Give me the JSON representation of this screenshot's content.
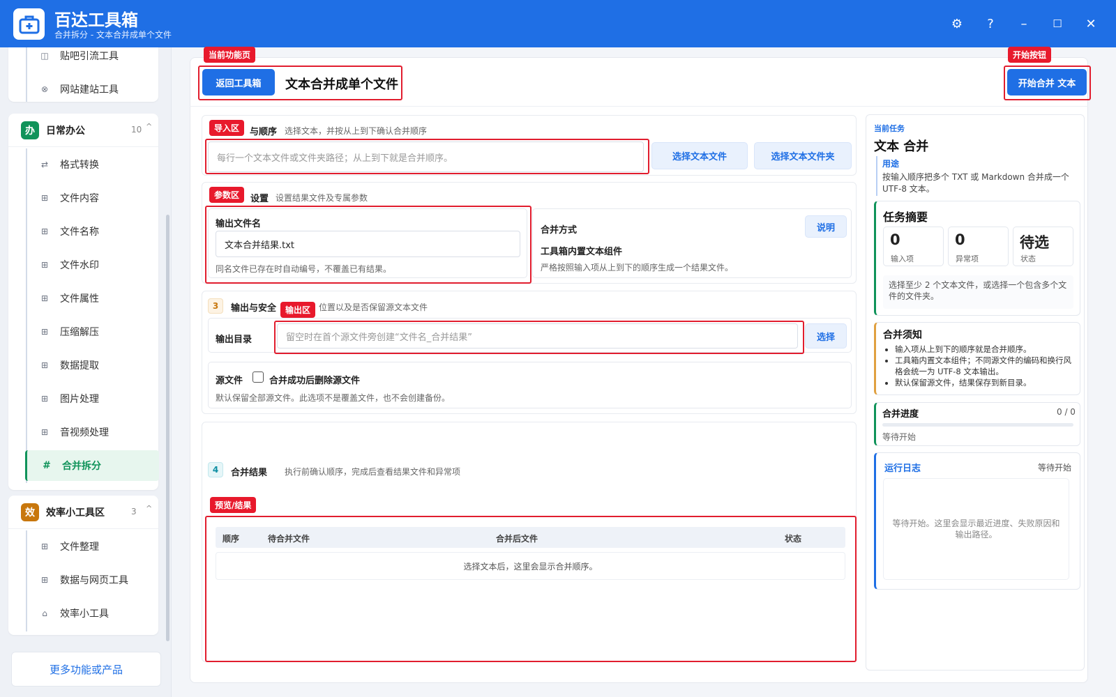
{
  "app": {
    "title": "百达工具箱",
    "subtitle": "合并拆分 - 文本合并成单个文件"
  },
  "window_controls": {
    "settings": "⚙",
    "help": "?",
    "minimize": "–",
    "maximize": "☐",
    "close": "✕"
  },
  "sidebar": {
    "top_items": [
      {
        "icon": "◫",
        "label": "贴吧引流工具"
      },
      {
        "icon": "⊗",
        "label": "网站建站工具"
      }
    ],
    "groups": [
      {
        "badge": "办",
        "badge_color": "#10935a",
        "title": "日常办公",
        "count": "10",
        "caret": "^",
        "items": [
          {
            "icon": "⇄",
            "label": "格式转换"
          },
          {
            "icon": "⊞",
            "label": "文件内容"
          },
          {
            "icon": "⊞",
            "label": "文件名称"
          },
          {
            "icon": "⊞",
            "label": "文件水印"
          },
          {
            "icon": "⊞",
            "label": "文件属性"
          },
          {
            "icon": "⊞",
            "label": "压缩解压"
          },
          {
            "icon": "⊞",
            "label": "数据提取"
          },
          {
            "icon": "⊞",
            "label": "图片处理"
          },
          {
            "icon": "⊞",
            "label": "音视频处理"
          },
          {
            "icon": "#",
            "label": "合并拆分",
            "active": true
          }
        ]
      },
      {
        "badge": "效",
        "badge_color": "#c8770d",
        "title": "效率小工具区",
        "count": "3",
        "caret": "^",
        "items": [
          {
            "icon": "⊞",
            "label": "文件整理"
          },
          {
            "icon": "⊞",
            "label": "数据与网页工具"
          },
          {
            "icon": "⌂",
            "label": "效率小工具"
          }
        ]
      }
    ],
    "more_button": "更多功能或产品"
  },
  "header": {
    "back_button": "返回工具箱",
    "page_title": "文本合并成单个文件",
    "start_button": "开始合并 文本"
  },
  "callouts": {
    "current_page": "当前功能页",
    "start": "开始按钮",
    "import": "导入区",
    "params": "参数区",
    "output": "输出区",
    "preview": "预览/结果"
  },
  "section1": {
    "title_visible": "与顺序",
    "desc": "选择文本，并按从上到下确认合并顺序",
    "placeholder": "每行一个文本文件或文件夹路径；从上到下就是合并顺序。",
    "btn_select_files": "选择文本文件",
    "btn_select_folder": "选择文本文件夹"
  },
  "section2": {
    "title_visible": "设置",
    "desc": "设置结果文件及专属参数",
    "filename_label": "输出文件名",
    "filename_value": "文本合并结果.txt",
    "filename_hint": "同名文件已存在时自动编号，不覆盖已有结果。",
    "mode_label": "合并方式",
    "mode_help": "说明",
    "mode_value": "工具箱内置文本组件",
    "mode_hint": "严格按照输入项从上到下的顺序生成一个结果文件。"
  },
  "section3": {
    "num": "3",
    "title": "输出与安全",
    "desc": "位置以及是否保留源文本文件",
    "dir_label": "输出目录",
    "dir_placeholder": "留空时在首个源文件旁创建“文件名_合并结果”",
    "dir_button": "选择",
    "source_label": "源文件",
    "delete_label": "合并成功后删除源文件",
    "source_hint": "默认保留全部源文件。此选项不是覆盖文件，也不会创建备份。"
  },
  "section4": {
    "num": "4",
    "title": "合并结果",
    "desc": "执行前确认顺序，完成后查看结果文件和异常项",
    "columns": [
      "顺序",
      "待合并文件",
      "合并后文件",
      "状态"
    ],
    "empty": "选择文本后，这里会显示合并顺序。"
  },
  "right": {
    "task_caption": "当前任务",
    "task_title": "文本 合并",
    "usage_label": "用途",
    "usage_text": "按输入顺序把多个 TXT 或 Markdown 合并成一个 UTF-8 文本。",
    "summary_title": "任务摘要",
    "stats": [
      {
        "value": "0",
        "label": "输入项"
      },
      {
        "value": "0",
        "label": "异常项"
      },
      {
        "value": "待选",
        "label": "状态"
      }
    ],
    "summary_hint": "选择至少 2 个文本文件，或选择一个包含多个文件的文件夹。",
    "notes_title": "合并须知",
    "notes": [
      "输入项从上到下的顺序就是合并顺序。",
      "工具箱内置文本组件；不同源文件的编码和换行风格会统一为 UTF-8 文本输出。",
      "默认保留源文件，结果保存到新目录。"
    ],
    "progress_title": "合并进度",
    "progress_count": "0 / 0",
    "progress_value": 0,
    "progress_status": "等待开始",
    "log_title": "运行日志",
    "log_status": "等待开始",
    "log_empty": "等待开始。这里会显示最近进度、失败原因和输出路径。"
  },
  "colors": {
    "primary": "#1f6fe5",
    "success": "#10935a",
    "warning": "#c8770d",
    "annotation": "#e11d2e"
  }
}
